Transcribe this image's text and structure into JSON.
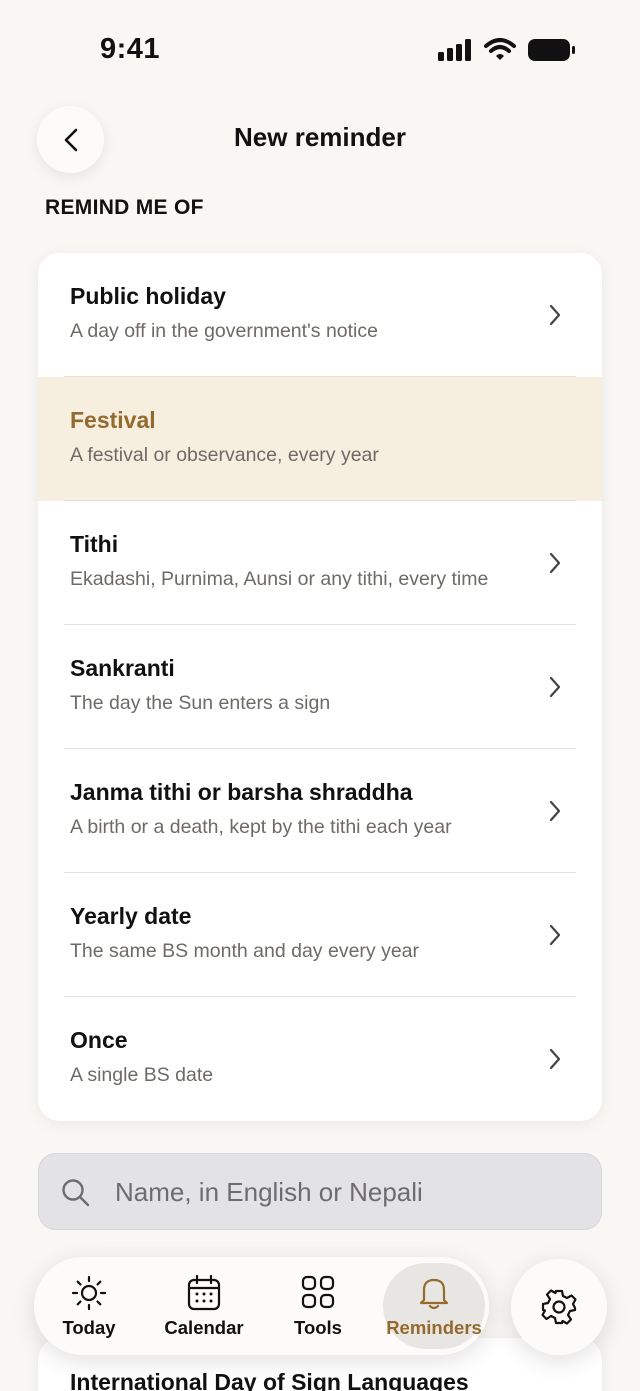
{
  "status": {
    "time": "9:41"
  },
  "header": {
    "title": "New reminder"
  },
  "section": {
    "label": "REMIND ME OF"
  },
  "options": [
    {
      "title": "Public holiday",
      "subtitle": "A day off in the government's notice",
      "selected": false
    },
    {
      "title": "Festival",
      "subtitle": "A festival or observance, every year",
      "selected": true
    },
    {
      "title": "Tithi",
      "subtitle": "Ekadashi, Purnima, Aunsi or any tithi, every time",
      "selected": false
    },
    {
      "title": "Sankranti",
      "subtitle": "The day the Sun enters a sign",
      "selected": false
    },
    {
      "title": "Janma tithi or barsha shraddha",
      "subtitle": "A birth or a death, kept by the tithi each year",
      "selected": false
    },
    {
      "title": "Yearly date",
      "subtitle": "The same BS month and day every year",
      "selected": false
    },
    {
      "title": "Once",
      "subtitle": "A single BS date",
      "selected": false
    }
  ],
  "search": {
    "placeholder": "Name, in English or Nepali",
    "value": ""
  },
  "peek": {
    "title": "International Day of Sign Languages"
  },
  "tabs": [
    {
      "label": "Today",
      "icon": "sun-icon",
      "active": false
    },
    {
      "label": "Calendar",
      "icon": "calendar-icon",
      "active": false
    },
    {
      "label": "Tools",
      "icon": "grid-icon",
      "active": false
    },
    {
      "label": "Reminders",
      "icon": "bell-icon",
      "active": true
    }
  ],
  "settings": {
    "icon": "gear-icon"
  },
  "colors": {
    "accent": "#956a2e",
    "selected_bg": "#f6efe0",
    "background": "#f8f7f4"
  }
}
